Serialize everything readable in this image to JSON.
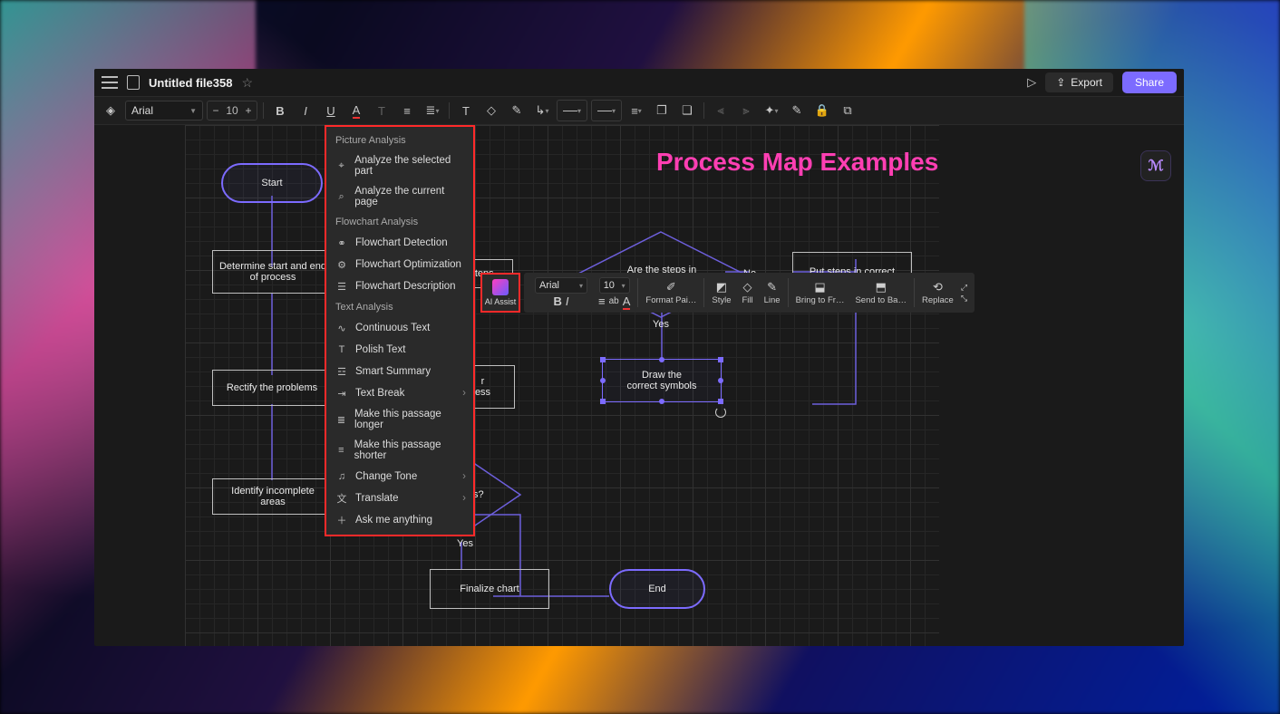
{
  "header": {
    "file_title": "Untitled file358",
    "export_label": "Export",
    "share_label": "Share"
  },
  "toolbar": {
    "font": "Arial",
    "size": "10"
  },
  "canvas": {
    "title": "Process Map Examples",
    "nodes": {
      "start": "Start",
      "determine": "Determine start and end of process",
      "steps": "steps",
      "decision1": "Are the steps in",
      "no1": "No",
      "yes1": "Yes",
      "put_order": "Put steps in correct",
      "rectify": "Rectify the problems",
      "rightside_partial": "r\ness",
      "draw": "Draw the\ncorrect symbols",
      "identify": "Identify incomplete areas",
      "decision2_partial": "s?",
      "yes2": "Yes",
      "finalize": "Finalize chart",
      "end": "End"
    }
  },
  "ctx_menu": {
    "picture_hdr": "Picture Analysis",
    "analyze_sel": "Analyze the selected part",
    "analyze_page": "Analyze the current page",
    "flow_hdr": "Flowchart Analysis",
    "flow_detect": "Flowchart Detection",
    "flow_opt": "Flowchart Optimization",
    "flow_desc": "Flowchart Description",
    "text_hdr": "Text Analysis",
    "cont_text": "Continuous Text",
    "polish": "Polish Text",
    "summary": "Smart Summary",
    "break": "Text Break",
    "longer": "Make this passage longer",
    "shorter": "Make this passage shorter",
    "tone": "Change Tone",
    "translate": "Translate",
    "ask": "Ask me anything"
  },
  "ai_assist": {
    "label": "AI Assist"
  },
  "float_tb": {
    "font": "Arial",
    "size": "10",
    "format_painter": "Format Pai…",
    "style": "Style",
    "fill": "Fill",
    "line": "Line",
    "bring_front": "Bring to Fr…",
    "send_back": "Send to Ba…",
    "replace": "Replace"
  }
}
